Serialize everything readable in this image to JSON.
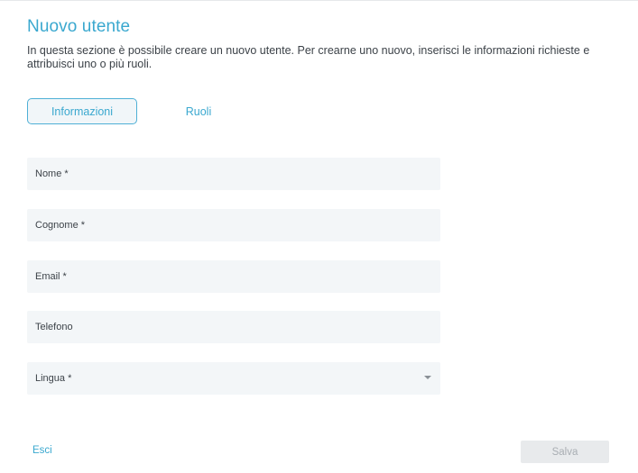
{
  "header": {
    "title": "Nuovo utente",
    "description": "In questa sezione è possibile creare un nuovo utente. Per crearne uno nuovo, inserisci le informazioni richieste e attribuisci uno o più ruoli."
  },
  "tabs": [
    {
      "label": "Informazioni",
      "active": true
    },
    {
      "label": "Ruoli",
      "active": false
    }
  ],
  "form": {
    "fields": [
      {
        "label": "Nome *",
        "value": ""
      },
      {
        "label": "Cognome *",
        "value": ""
      },
      {
        "label": "Email *",
        "value": ""
      },
      {
        "label": "Telefono",
        "value": ""
      },
      {
        "label": "Lingua *",
        "value": "",
        "icon": "chevron-down-icon"
      }
    ]
  },
  "footer": {
    "exit_label": "Esci",
    "save_label": "Salva",
    "save_disabled": true
  },
  "colors": {
    "accent": "#3aa8cf",
    "field_bg": "#f3f6f8",
    "disabled_bg": "#e8eaec"
  }
}
